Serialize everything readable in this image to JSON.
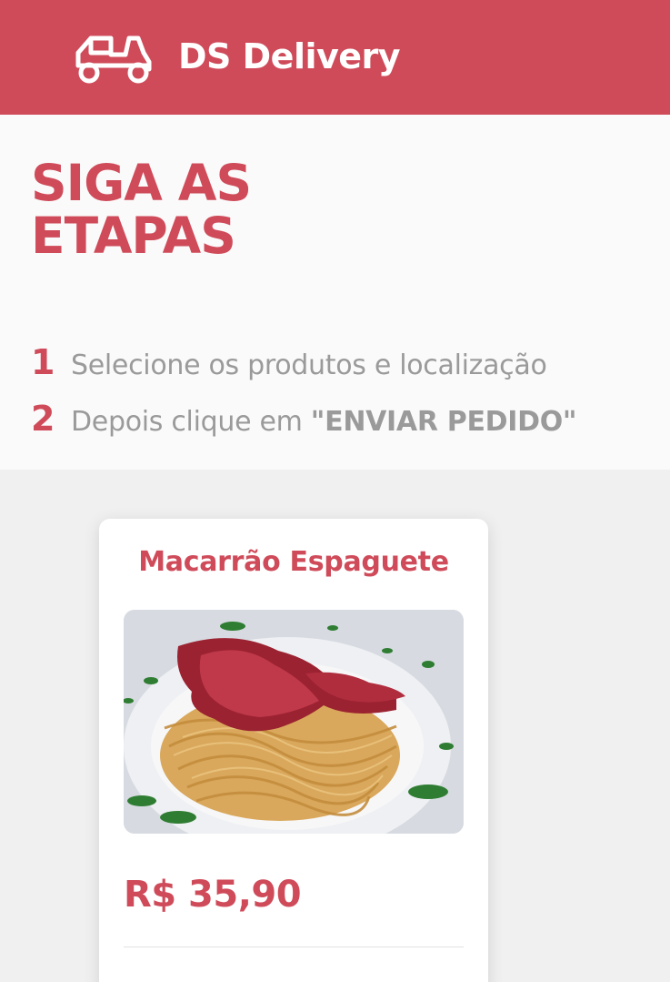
{
  "header": {
    "brand": "DS Delivery",
    "icon": "delivery-scooter-icon"
  },
  "steps": {
    "title_line1": "SIGA AS",
    "title_line2": "ETAPAS",
    "items": [
      {
        "number": "1",
        "text": "Selecione os produtos e localização"
      },
      {
        "number": "2",
        "text": "Depois clique em ",
        "strong": "\"ENVIAR PEDIDO\""
      }
    ]
  },
  "product": {
    "name": "Macarrão Espaguete",
    "price": "R$ 35,90",
    "image": "spaghetti-with-shrimp-photo"
  },
  "colors": {
    "brand": "#cf4b5a",
    "text_muted": "#9a9a9a",
    "section_bg": "#f0f0f0"
  }
}
